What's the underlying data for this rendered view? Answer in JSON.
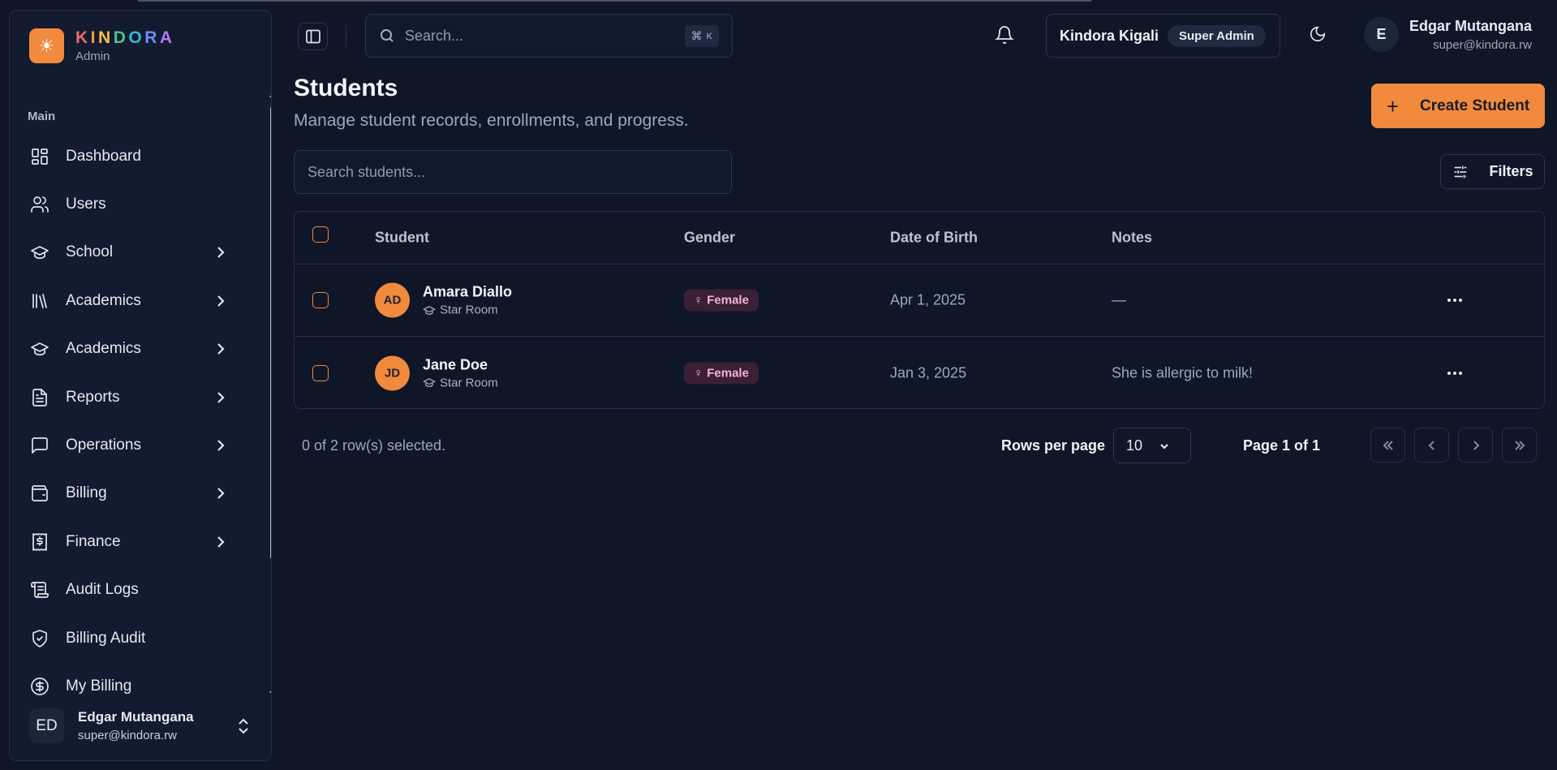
{
  "brand": {
    "name_letters": [
      "K",
      "I",
      "N",
      "D",
      "O",
      "R",
      "A"
    ],
    "subtitle": "Admin",
    "logo_icon": "sun-icon",
    "accent": "#f28a3e"
  },
  "sidebar": {
    "group_label": "Main",
    "items": [
      {
        "label": "Dashboard",
        "icon": "dashboard-icon",
        "has_children": false
      },
      {
        "label": "Users",
        "icon": "users-icon",
        "has_children": false
      },
      {
        "label": "School",
        "icon": "graduation-cap-icon",
        "has_children": true
      },
      {
        "label": "Academics",
        "icon": "library-icon",
        "has_children": true
      },
      {
        "label": "Academics",
        "icon": "graduation-cap-icon",
        "has_children": true
      },
      {
        "label": "Reports",
        "icon": "file-text-icon",
        "has_children": true
      },
      {
        "label": "Operations",
        "icon": "message-square-icon",
        "has_children": true
      },
      {
        "label": "Billing",
        "icon": "wallet-icon",
        "has_children": true
      },
      {
        "label": "Finance",
        "icon": "receipt-dollar-icon",
        "has_children": true
      },
      {
        "label": "Audit Logs",
        "icon": "scroll-icon",
        "has_children": false
      },
      {
        "label": "Billing Audit",
        "icon": "shield-check-icon",
        "has_children": false
      },
      {
        "label": "My Billing",
        "icon": "dollar-circle-icon",
        "has_children": false
      }
    ],
    "user": {
      "initials": "ED",
      "name": "Edgar Mutangana",
      "email": "super@kindora.rw"
    }
  },
  "header": {
    "search_placeholder": "Search...",
    "shortcut_symbol": "⌘",
    "shortcut_key": "K",
    "org_name": "Kindora Kigali",
    "role": "Super Admin",
    "user": {
      "initial": "E",
      "name": "Edgar Mutangana",
      "email": "super@kindora.rw"
    }
  },
  "page": {
    "title": "Students",
    "subtitle": "Manage student records, enrollments, and progress.",
    "create_label": "Create Student",
    "search_placeholder": "Search students...",
    "filters_label": "Filters"
  },
  "table": {
    "columns": [
      "Student",
      "Gender",
      "Date of Birth",
      "Notes"
    ],
    "rows": [
      {
        "initials": "AD",
        "name": "Amara Diallo",
        "room": "Star Room",
        "gender": "Female",
        "dob": "Apr 1, 2025",
        "notes": "—"
      },
      {
        "initials": "JD",
        "name": "Jane Doe",
        "room": "Star Room",
        "gender": "Female",
        "dob": "Jan 3, 2025",
        "notes": "She is allergic to milk!"
      }
    ]
  },
  "pagination": {
    "selected_text": "0 of 2 row(s) selected.",
    "rows_per_page_label": "Rows per page",
    "rows_per_page_value": "10",
    "page_info": "Page 1 of 1"
  }
}
